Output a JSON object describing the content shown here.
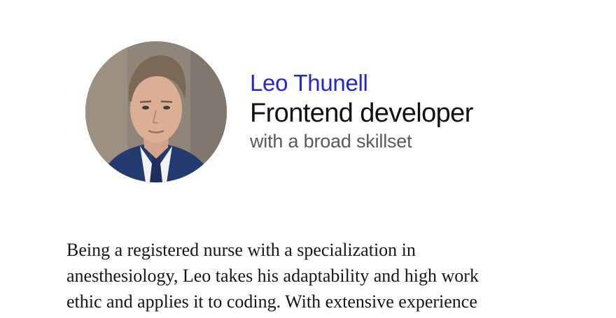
{
  "profile": {
    "name": "Leo Thunell",
    "role": "Frontend developer",
    "tagline": "with a broad skillset",
    "avatar_icon": "person-photo",
    "bio": "Being a registered nurse with a specialization in anesthesiology, Leo takes his adaptability and high work ethic and applies it to coding. With extensive experience"
  },
  "colors": {
    "name": "#1f27d9",
    "role": "#111111",
    "tagline": "#5a5a5a",
    "body_text": "#161616",
    "background": "#ffffff"
  }
}
